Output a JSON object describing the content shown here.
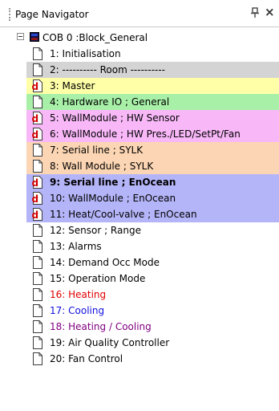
{
  "panel": {
    "title": "Page Navigator",
    "pin_glyph": "pin-icon",
    "close_glyph": "×"
  },
  "tree": {
    "root_label": "COB 0 :Block_General",
    "rows": [
      {
        "label": "1: Initialisation",
        "bg": "#ffffff",
        "color": "#000000",
        "icon": "page",
        "bold": false
      },
      {
        "label": "2: ---------- Room ----------",
        "bg": "#d4d4d4",
        "color": "#000000",
        "icon": "page",
        "bold": false
      },
      {
        "label": "3: Master",
        "bg": "#ffffa8",
        "color": "#000000",
        "icon": "d",
        "bold": false
      },
      {
        "label": "4: Hardware IO ; General",
        "bg": "#a8f0a8",
        "color": "#000000",
        "icon": "page",
        "bold": false
      },
      {
        "label": "5: WallModule ; HW Sensor",
        "bg": "#f8b8f8",
        "color": "#000000",
        "icon": "d",
        "bold": false
      },
      {
        "label": "6: WallModule ; HW Pres./LED/SetPt/Fan",
        "bg": "#f8b8f8",
        "color": "#000000",
        "icon": "d",
        "bold": false
      },
      {
        "label": "7: Serial line ; SYLK",
        "bg": "#fcd6b4",
        "color": "#000000",
        "icon": "page",
        "bold": false
      },
      {
        "label": "8: Wall Module ; SYLK",
        "bg": "#fcd6b4",
        "color": "#000000",
        "icon": "page",
        "bold": false
      },
      {
        "label": "9: Serial line ; EnOcean",
        "bg": "#b4b4f8",
        "color": "#000000",
        "icon": "d",
        "bold": true
      },
      {
        "label": "10: WallModule ; EnOcean",
        "bg": "#b4b4f8",
        "color": "#000000",
        "icon": "d",
        "bold": false
      },
      {
        "label": "11: Heat/Cool-valve ; EnOcean",
        "bg": "#b4b4f8",
        "color": "#000000",
        "icon": "d",
        "bold": false
      },
      {
        "label": "12: Sensor ; Range",
        "bg": "#ffffff",
        "color": "#000000",
        "icon": "page",
        "bold": false
      },
      {
        "label": "13: Alarms",
        "bg": "#ffffff",
        "color": "#000000",
        "icon": "page",
        "bold": false
      },
      {
        "label": "14: Demand Occ Mode",
        "bg": "#ffffff",
        "color": "#000000",
        "icon": "page",
        "bold": false
      },
      {
        "label": "15: Operation Mode",
        "bg": "#ffffff",
        "color": "#000000",
        "icon": "page",
        "bold": false
      },
      {
        "label": "16: Heating",
        "bg": "#ffffff",
        "color": "#e00000",
        "icon": "page",
        "bold": false
      },
      {
        "label": "17: Cooling",
        "bg": "#ffffff",
        "color": "#1010e0",
        "icon": "page",
        "bold": false
      },
      {
        "label": "18: Heating / Cooling",
        "bg": "#ffffff",
        "color": "#800080",
        "icon": "page",
        "bold": false
      },
      {
        "label": "19: Air Quality Controller",
        "bg": "#ffffff",
        "color": "#000000",
        "icon": "page",
        "bold": false
      },
      {
        "label": "20: Fan Control",
        "bg": "#ffffff",
        "color": "#000000",
        "icon": "page",
        "bold": false
      }
    ]
  }
}
